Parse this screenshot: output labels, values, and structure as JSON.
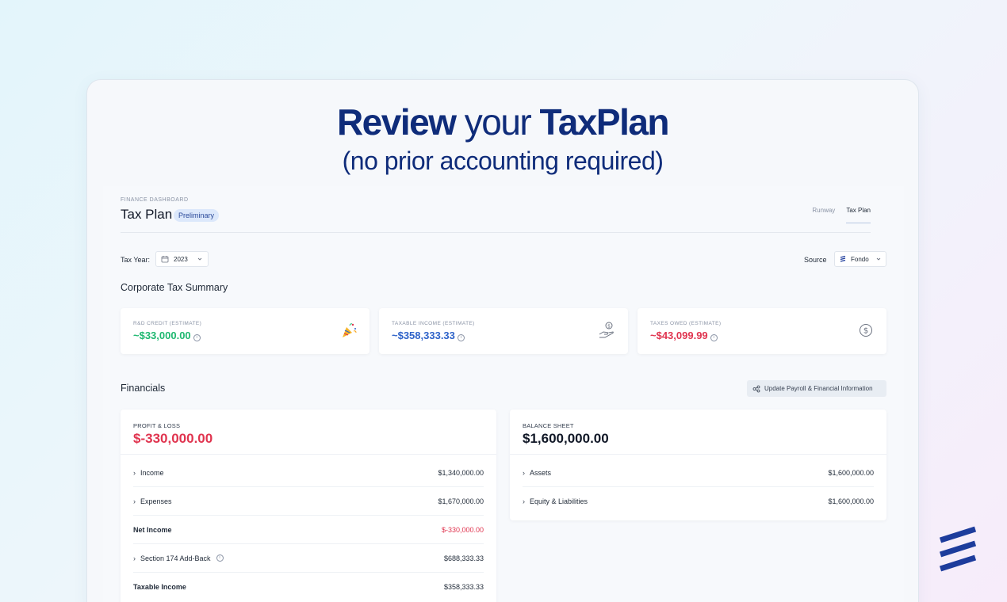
{
  "hero": {
    "line1_bold1": "Review",
    "line1_normal": "your",
    "line1_bold2": "TaxPlan",
    "line2": "(no prior accounting required)"
  },
  "header": {
    "eyebrow": "FINANCE DASHBOARD",
    "title": "Tax Plan",
    "badge": "Preliminary",
    "tabs": [
      {
        "label": "Runway",
        "active": false
      },
      {
        "label": "Tax Plan",
        "active": true
      }
    ]
  },
  "filters": {
    "tax_year_label": "Tax Year:",
    "tax_year_value": "2023",
    "source_label": "Source",
    "source_value": "Fondo"
  },
  "summary": {
    "title": "Corporate Tax Summary",
    "cards": [
      {
        "label": "R&D CREDIT (ESTIMATE)",
        "value": "~$33,000.00",
        "color": "#1fb871",
        "icon": "party-popper-icon"
      },
      {
        "label": "TAXABLE INCOME (ESTIMATE)",
        "value": "~$358,333.33",
        "color": "#2f63c9",
        "icon": "hand-dollar-icon"
      },
      {
        "label": "TAXES OWED (ESTIMATE)",
        "value": "~$43,099.99",
        "color": "#e0344f",
        "icon": "dollar-circle-icon"
      }
    ]
  },
  "financials": {
    "title": "Financials",
    "update_button": "Update Payroll & Financial Information",
    "profit_loss": {
      "label": "PROFIT & LOSS",
      "total": "$-330,000.00",
      "total_color": "#e0344f",
      "rows": [
        {
          "label": "Income",
          "amount": "$1,340,000.00",
          "expandable": true
        },
        {
          "label": "Expenses",
          "amount": "$1,670,000.00",
          "expandable": true
        },
        {
          "label": "Net Income",
          "amount": "$-330,000.00",
          "bold": true,
          "amount_color": "#e0344f"
        },
        {
          "label": "Section 174 Add-Back",
          "amount": "$688,333.33",
          "expandable": true,
          "info": true
        },
        {
          "label": "Taxable Income",
          "amount": "$358,333.33",
          "bold": true
        }
      ]
    },
    "balance_sheet": {
      "label": "BALANCE SHEET",
      "total": "$1,600,000.00",
      "total_color": "#111827",
      "rows": [
        {
          "label": "Assets",
          "amount": "$1,600,000.00",
          "expandable": true
        },
        {
          "label": "Equity & Liabilities",
          "amount": "$1,600,000.00",
          "expandable": true
        }
      ]
    }
  },
  "colors": {
    "brand": "#0f2c7a",
    "logo": "#1d3c9c"
  }
}
